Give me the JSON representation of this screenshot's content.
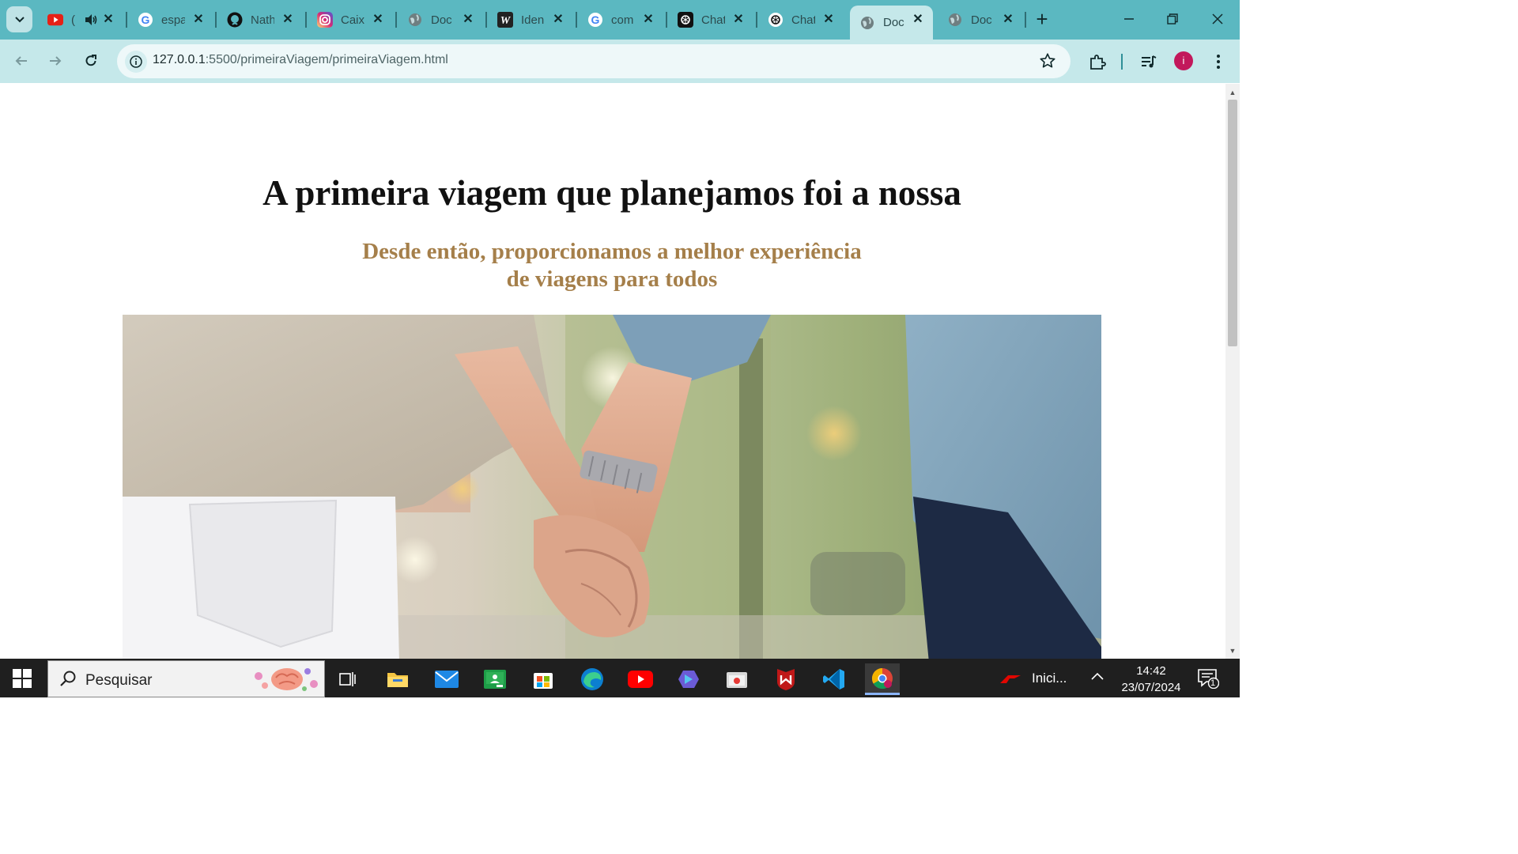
{
  "browser": {
    "tabs": [
      {
        "title": "(",
        "icon": "youtube-icon",
        "audio": true
      },
      {
        "title": "espa",
        "icon": "google-icon"
      },
      {
        "title": "Nath",
        "icon": "github-icon"
      },
      {
        "title": "Caix",
        "icon": "instagram-icon"
      },
      {
        "title": "Doc",
        "icon": "globe-icon"
      },
      {
        "title": "Iden",
        "icon": "wordpress-w-icon"
      },
      {
        "title": "com",
        "icon": "google-icon"
      },
      {
        "title": "Chat",
        "icon": "chatgpt-icon"
      },
      {
        "title": "Chat",
        "icon": "chatgpt-icon"
      },
      {
        "title": "Doc",
        "icon": "globe-icon",
        "active": true
      },
      {
        "title": "Doc",
        "icon": "globe-icon"
      }
    ],
    "url_host": "127.0.0.1",
    "url_path": ":5500/primeiraViagem/primeiraViagem.html",
    "avatar_letter": "i",
    "accent": "#5bb8c1"
  },
  "page": {
    "headline_normal": "A primeira viagem que planejamos ",
    "headline_bold": "foi a nossa",
    "subhead_line1": "Desde então, proporcionamos a melhor experiência",
    "subhead_line2_normal": "de ",
    "subhead_line2_bold": "viagens para todos",
    "subhead_color": "#a57f4a",
    "hero_image": "couple-holding-hands-photo"
  },
  "taskbar": {
    "search_placeholder": "Pesquisar",
    "apps": [
      "task-view-icon",
      "file-explorer-icon",
      "mail-icon",
      "classroom-icon",
      "microsoft-store-icon",
      "edge-icon",
      "youtube-icon",
      "copilot-icon",
      "app-icon",
      "mcafee-icon",
      "vscode-icon",
      "chrome-icon"
    ],
    "news_text": "Inici...",
    "time": "14:42",
    "date": "23/07/2024",
    "notification_count": "1"
  }
}
